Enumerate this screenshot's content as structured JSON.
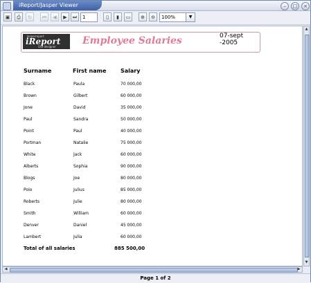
{
  "window": {
    "title": "iReport/Jasper Viewer"
  },
  "window_controls": {
    "minimize": "–",
    "maximize": "□",
    "close": "×"
  },
  "toolbar": {
    "save": "▣",
    "print": "⎙",
    "reload": "↻",
    "first": "⏮",
    "prev": "◀",
    "next": "▶",
    "last": "⏭",
    "page_value": "1",
    "actual_size": "▯",
    "fit_page": "▮",
    "fit_width": "▭",
    "zoom_in": "⊕",
    "zoom_out": "⊖",
    "zoom_value": "100%",
    "zoom_arrow": "▼"
  },
  "report": {
    "logo_top": "Jasperreport",
    "logo_main": "iReport",
    "logo_bottom": "GUI designer",
    "title": "Employee Salaries",
    "date": "07-sept -2005",
    "headers": {
      "surname": "Surname",
      "first_name": "First name",
      "salary": "Salary"
    },
    "rows": [
      {
        "surname": "Black",
        "first_name": "Paula",
        "salary": "70 000,00"
      },
      {
        "surname": "Brown",
        "first_name": "Gilbert",
        "salary": "60 000,00"
      },
      {
        "surname": "Jone",
        "first_name": "David",
        "salary": "35 000,00"
      },
      {
        "surname": "Paul",
        "first_name": "Sandra",
        "salary": "50 000,00"
      },
      {
        "surname": "Point",
        "first_name": "Paul",
        "salary": "40 000,00"
      },
      {
        "surname": "Portman",
        "first_name": "Natalie",
        "salary": "75 000,00"
      },
      {
        "surname": "White",
        "first_name": "Jack",
        "salary": "60 000,00"
      },
      {
        "surname": "Alberts",
        "first_name": "Sophia",
        "salary": "90 000,00"
      },
      {
        "surname": "Blogs",
        "first_name": "Joe",
        "salary": "80 000,00"
      },
      {
        "surname": "Polo",
        "first_name": "Julius",
        "salary": "85 000,00"
      },
      {
        "surname": "Roberts",
        "first_name": "Julie",
        "salary": "80 000,00"
      },
      {
        "surname": "Smith",
        "first_name": "William",
        "salary": "60 000,00"
      },
      {
        "surname": "Denver",
        "first_name": "Daniel",
        "salary": "45 000,00"
      },
      {
        "surname": "Lambert",
        "first_name": "Julia",
        "salary": "60 000,00"
      }
    ],
    "total_label": "Total of all salaries",
    "total_value": "885 500,00"
  },
  "scroll": {
    "up": "▲",
    "down": "▼",
    "left": "◀",
    "right": "▶"
  },
  "status": {
    "page_text": "Page 1 of 2"
  }
}
